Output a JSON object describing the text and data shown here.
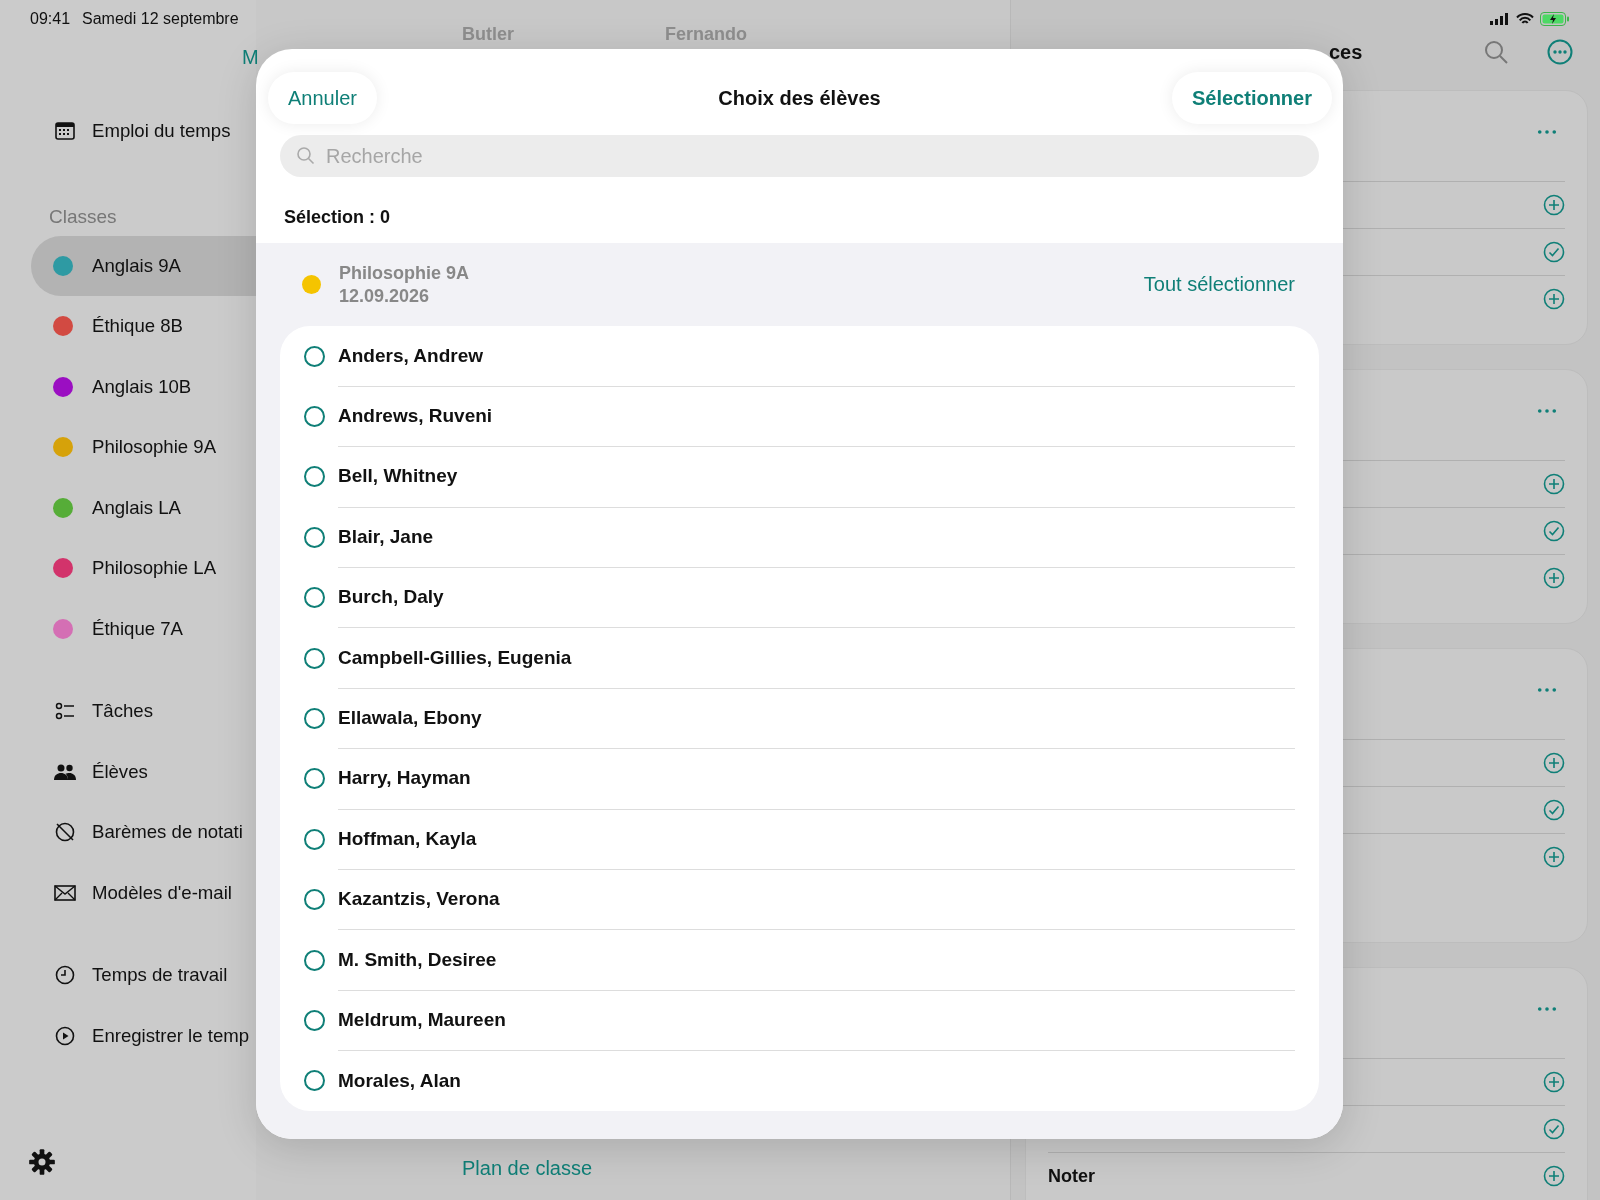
{
  "status_bar": {
    "time": "09:41",
    "date": "Samedi 12 septembre"
  },
  "sidebar": {
    "top_items": [
      {
        "kind": "calendar",
        "label": "Emploi du temps"
      }
    ],
    "classes_header": "Classes",
    "classes": [
      {
        "label": "Anglais 9A",
        "color": "#2e9aa3",
        "selected": true
      },
      {
        "label": "Éthique 8B",
        "color": "#d24a42",
        "selected": false
      },
      {
        "label": "Anglais 10B",
        "color": "#9b0ec2",
        "selected": false
      },
      {
        "label": "Philosophie 9A",
        "color": "#d6a20a",
        "selected": false
      },
      {
        "label": "Anglais LA",
        "color": "#56ad38",
        "selected": false
      },
      {
        "label": "Philosophie LA",
        "color": "#d2336b",
        "selected": false
      },
      {
        "label": "Éthique 7A",
        "color": "#d46fb4",
        "selected": false
      }
    ],
    "tools": [
      {
        "kind": "tasks",
        "label": "Tâches"
      },
      {
        "kind": "students",
        "label": "Élèves"
      },
      {
        "kind": "scale",
        "label": "Barèmes de notati"
      },
      {
        "kind": "mail",
        "label": "Modèles d'e-mail"
      }
    ],
    "time_items": [
      {
        "kind": "clock",
        "label": "Temps de travail"
      },
      {
        "kind": "play",
        "label": "Enregistrer le temp"
      }
    ]
  },
  "middle": {
    "back_link": "M",
    "header_names": [
      "Butler",
      "Fernando"
    ],
    "bottom_link": "Plan de classe"
  },
  "right_panel": {
    "title": "ces",
    "cards": [
      {
        "rows": [
          {
            "kind": "add"
          },
          {
            "kind": "check"
          },
          {
            "kind": "add"
          }
        ]
      },
      {
        "rows": [
          {
            "kind": "add"
          },
          {
            "kind": "check"
          },
          {
            "kind": "add"
          }
        ]
      },
      {
        "rows": [
          {
            "kind": "add"
          },
          {
            "kind": "check"
          },
          {
            "kind": "add"
          }
        ]
      },
      {
        "rows": [
          {
            "kind": "add"
          },
          {
            "kind": "check"
          },
          {
            "kind": "add",
            "label": "Noter"
          }
        ]
      }
    ]
  },
  "modal": {
    "cancel": "Annuler",
    "title": "Choix des élèves",
    "confirm": "Sélectionner",
    "search": {
      "placeholder": "Recherche"
    },
    "selection_count": "Sélection : 0",
    "group": {
      "name": "Philosophie 9A",
      "date": "12.09.2026",
      "color": "#f5c400",
      "select_all": "Tout sélectionner"
    },
    "students": [
      {
        "name": "Anders, Andrew",
        "selected": false
      },
      {
        "name": "Andrews, Ruveni",
        "selected": false
      },
      {
        "name": "Bell, Whitney",
        "selected": false
      },
      {
        "name": "Blair, Jane",
        "selected": false
      },
      {
        "name": "Burch, Daly",
        "selected": false
      },
      {
        "name": "Campbell-Gillies, Eugenia",
        "selected": false
      },
      {
        "name": "Ellawala, Ebony",
        "selected": false
      },
      {
        "name": "Harry, Hayman",
        "selected": false
      },
      {
        "name": "Hoffman, Kayla",
        "selected": false
      },
      {
        "name": "Kazantzis, Verona",
        "selected": false
      },
      {
        "name": "M. Smith, Desiree",
        "selected": false
      },
      {
        "name": "Meldrum, Maureen",
        "selected": false
      },
      {
        "name": "Morales, Alan",
        "selected": false
      }
    ]
  }
}
